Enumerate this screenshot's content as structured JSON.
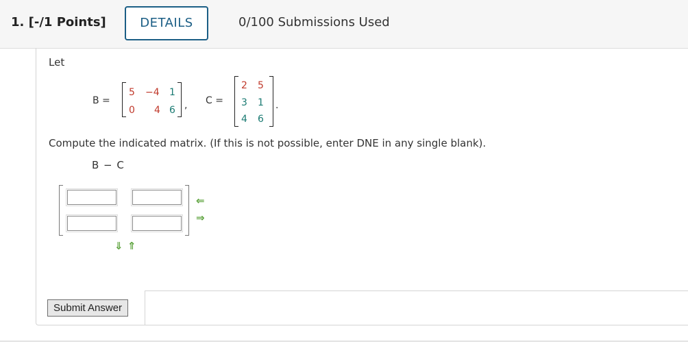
{
  "header": {
    "question_points": "1.  [-/1 Points]",
    "details_label": "DETAILS",
    "submissions": "0/100 Submissions Used"
  },
  "question": {
    "let_label": "Let",
    "matrix_b": {
      "label": "B =",
      "rows": [
        [
          "5",
          "−4",
          "1"
        ],
        [
          "0",
          "4",
          "6"
        ]
      ],
      "trailing": ","
    },
    "matrix_c": {
      "label": "C =",
      "rows": [
        [
          "2",
          "5"
        ],
        [
          "3",
          "1"
        ],
        [
          "4",
          "6"
        ]
      ],
      "trailing": "."
    },
    "instruction": "Compute the indicated matrix. (If this is not possible, enter DNE in any single blank).",
    "expression": "B − C"
  },
  "answer": {
    "cells": [
      [
        "",
        ""
      ],
      [
        "",
        ""
      ]
    ],
    "arrows": {
      "left": "⇐",
      "right": "⇒",
      "down": "⇓",
      "up": "⇑"
    }
  },
  "actions": {
    "submit_label": "Submit Answer"
  },
  "colors": {
    "accent": "#1b5e85",
    "number_red": "#c0392b",
    "number_teal": "#1a7a72",
    "arrow_green": "#5aa13a"
  }
}
